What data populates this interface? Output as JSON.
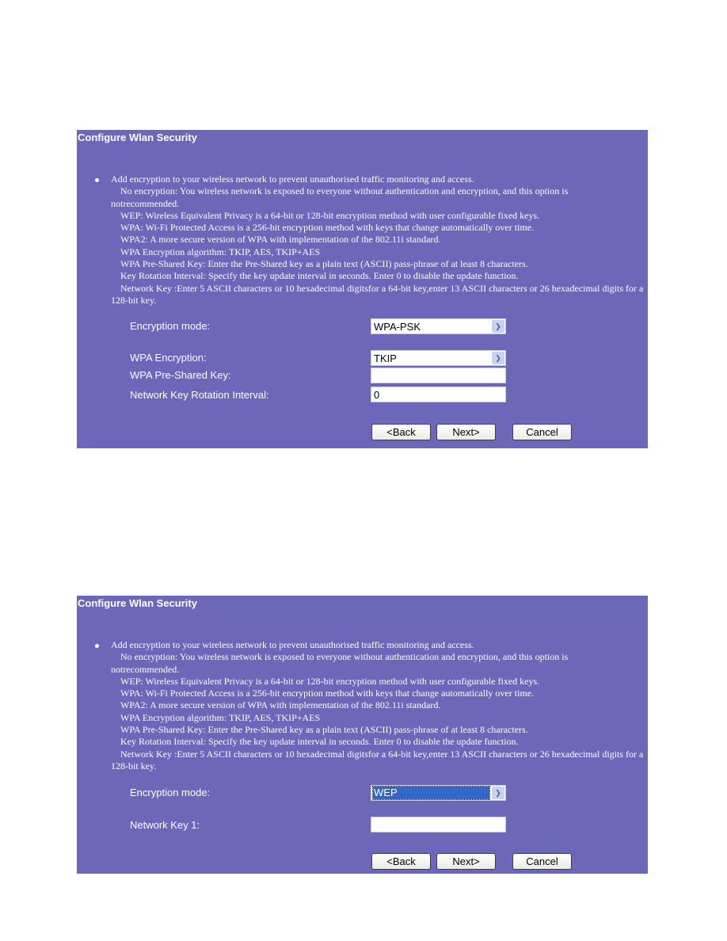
{
  "colors": {
    "panel_bg": "#6d67ba",
    "selection": "#3168c8"
  },
  "description": {
    "bullet": "Add encryption to your wireless network to prevent unauthorised traffic monitoring and access.",
    "no_encryption": "No encryption: You wireless network is exposed to everyone without authentication and encryption, and this option is",
    "no_encryption_cont": "notrecommended.",
    "wep": "WEP: Wireless Equivalent Privacy is a 64-bit or 128-bit encryption method with user configurable fixed keys.",
    "wpa": "WPA: Wi-Fi Protected Access is a 256-bit encryption method with keys that change automatically over time.",
    "wpa2": "WPA2: A more secure version of WPA with implementation of the 802.11i standard.",
    "algorithm": "WPA Encryption algorithm: TKIP, AES, TKIP+AES",
    "psk": "WPA Pre-Shared Key: Enter the Pre-Shared key as a plain text (ASCII) pass-phrase of at least 8 characters.",
    "rotation": "Key Rotation Interval: Specify the key update interval in seconds. Enter 0 to disable the update function.",
    "network_key": "Network Key :Enter 5 ASCII characters or 10 hexadecimal digitsfor a 64-bit key,enter 13 ASCII characters or 26 hexadecimal digits for a",
    "network_key_cont": "128-bit key."
  },
  "panels": [
    {
      "title": "Configure Wlan Security",
      "encryption_mode_label": "Encryption mode:",
      "encryption_mode_value": "WPA-PSK",
      "wpa_encryption_label": "WPA Encryption:",
      "wpa_encryption_value": "TKIP",
      "psk_label": "WPA Pre-Shared Key:",
      "psk_value": "",
      "rotation_label": "Network Key Rotation Interval:",
      "rotation_value": "0"
    },
    {
      "title": "Configure Wlan Security",
      "encryption_mode_label": "Encryption mode:",
      "encryption_mode_value": "WEP",
      "network_key_label": "Network Key 1:",
      "network_key_value": ""
    }
  ],
  "buttons": {
    "back": "<Back",
    "next": "Next>",
    "cancel": "Cancel"
  },
  "icons": {
    "dropdown": "chevron-down-icon"
  }
}
